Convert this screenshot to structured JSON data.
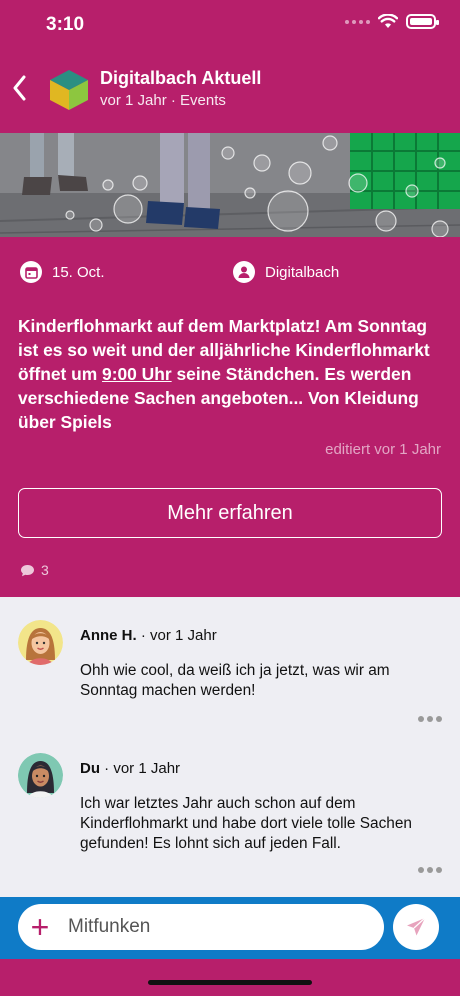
{
  "status_bar": {
    "time": "3:10"
  },
  "header": {
    "title": "Digitalbach Aktuell",
    "subtitle": "vor 1 Jahr · Events"
  },
  "post": {
    "date": "15. Oct.",
    "author": "Digitalbach",
    "text_before_link": "Kinderflohmarkt auf dem Marktplatz! Am Sonntag ist es so weit und der alljährliche Kinderflohmarkt öffnet um ",
    "link_text": "9:00 Uhr",
    "text_after_link": " seine Ständchen. Es werden verschiedene Sachen angeboten... Von Kleidung über Spiels",
    "edited": "editiert vor 1 Jahr",
    "more_button": "Mehr erfahren",
    "comment_count": "3"
  },
  "comments": [
    {
      "author": "Anne H.",
      "time": "· vor 1 Jahr",
      "text": "Ohh wie cool, da weiß ich ja jetzt, was wir am Sonntag machen werden!"
    },
    {
      "author": "Du",
      "time": "· vor 1 Jahr",
      "text": "Ich war letztes Jahr auch schon auf dem Kinderflohmarkt und habe dort viele tolle Sachen gefunden! Es lohnt sich auf jeden Fall."
    }
  ],
  "composer": {
    "placeholder": "Mitfunken"
  },
  "colors": {
    "brand": "#b71f6b",
    "composer_bar": "#0f7bc7",
    "comments_bg": "#eeeef3"
  },
  "icons": {
    "back": "chevron-left-icon",
    "channel_logo": "cube-icon",
    "date": "calendar-icon",
    "author": "person-icon",
    "comments": "speech-bubble-icon",
    "menu": "ellipsis-icon",
    "add": "plus-icon",
    "send": "paper-plane-icon"
  }
}
